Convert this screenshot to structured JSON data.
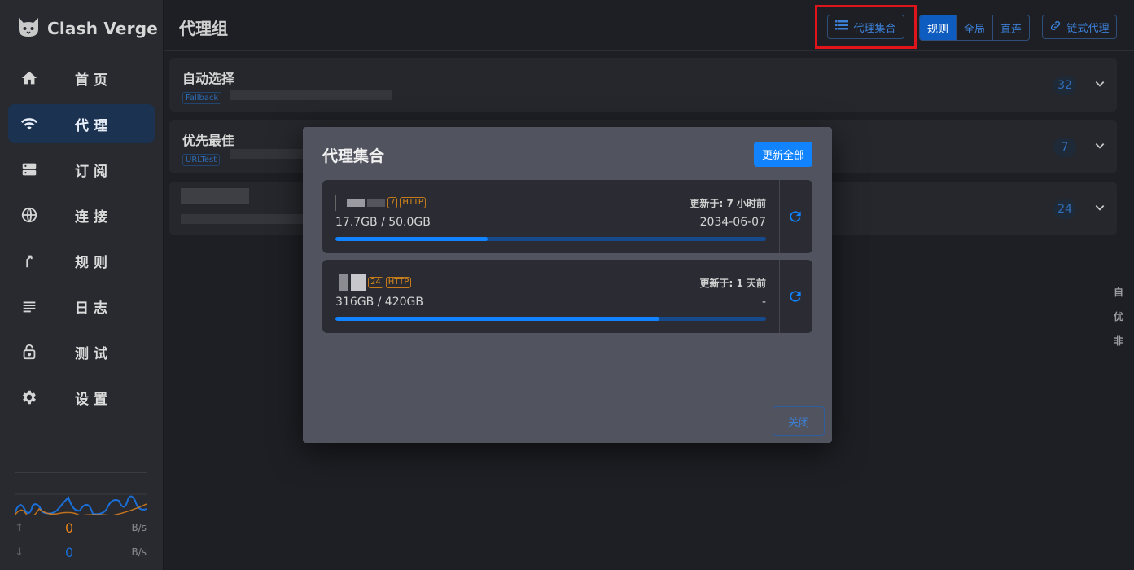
{
  "app": {
    "name": "Clash Verge"
  },
  "sidebar": {
    "items": [
      {
        "label": "首页",
        "icon": "home-icon"
      },
      {
        "label": "代理",
        "icon": "wifi-icon",
        "active": true
      },
      {
        "label": "订阅",
        "icon": "server-icon"
      },
      {
        "label": "连接",
        "icon": "globe-icon"
      },
      {
        "label": "规则",
        "icon": "fork-icon"
      },
      {
        "label": "日志",
        "icon": "list-icon"
      },
      {
        "label": "测试",
        "icon": "lock-icon"
      },
      {
        "label": "设置",
        "icon": "gear-icon"
      }
    ],
    "traffic": {
      "up": {
        "value": "0",
        "unit": "B/s",
        "color": "#e6831a"
      },
      "down": {
        "value": "0",
        "unit": "B/s",
        "color": "#1a6fd8"
      }
    }
  },
  "header": {
    "title": "代理组",
    "provider_button": "代理集合",
    "modes": [
      "规则",
      "全局",
      "直连"
    ],
    "active_mode": "规则",
    "chain_button": "链式代理"
  },
  "groups": [
    {
      "name": "自动选择",
      "tag": "Fallback",
      "count": "32"
    },
    {
      "name": "优先最佳",
      "tag": "URLTest",
      "count": "7"
    },
    {
      "name": "",
      "tag": "",
      "count": "24"
    }
  ],
  "right_labels": [
    "自",
    "优",
    "非"
  ],
  "dialog": {
    "title": "代理集合",
    "update_all": "更新全部",
    "close": "关闭",
    "providers": [
      {
        "count": "7",
        "type": "HTTP",
        "updated": "更新于: 7 小时前",
        "usage": "17.7GB / 50.0GB",
        "expire": "2034-06-07",
        "used_fraction": 0.354
      },
      {
        "count": "24",
        "type": "HTTP",
        "updated": "更新于: 1 天前",
        "usage": "316GB / 420GB",
        "expire": "-",
        "used_fraction": 0.752
      }
    ]
  },
  "colors": {
    "accent": "#1183ff",
    "highlight": "#e0141b",
    "active_nav": "#1b3351"
  }
}
